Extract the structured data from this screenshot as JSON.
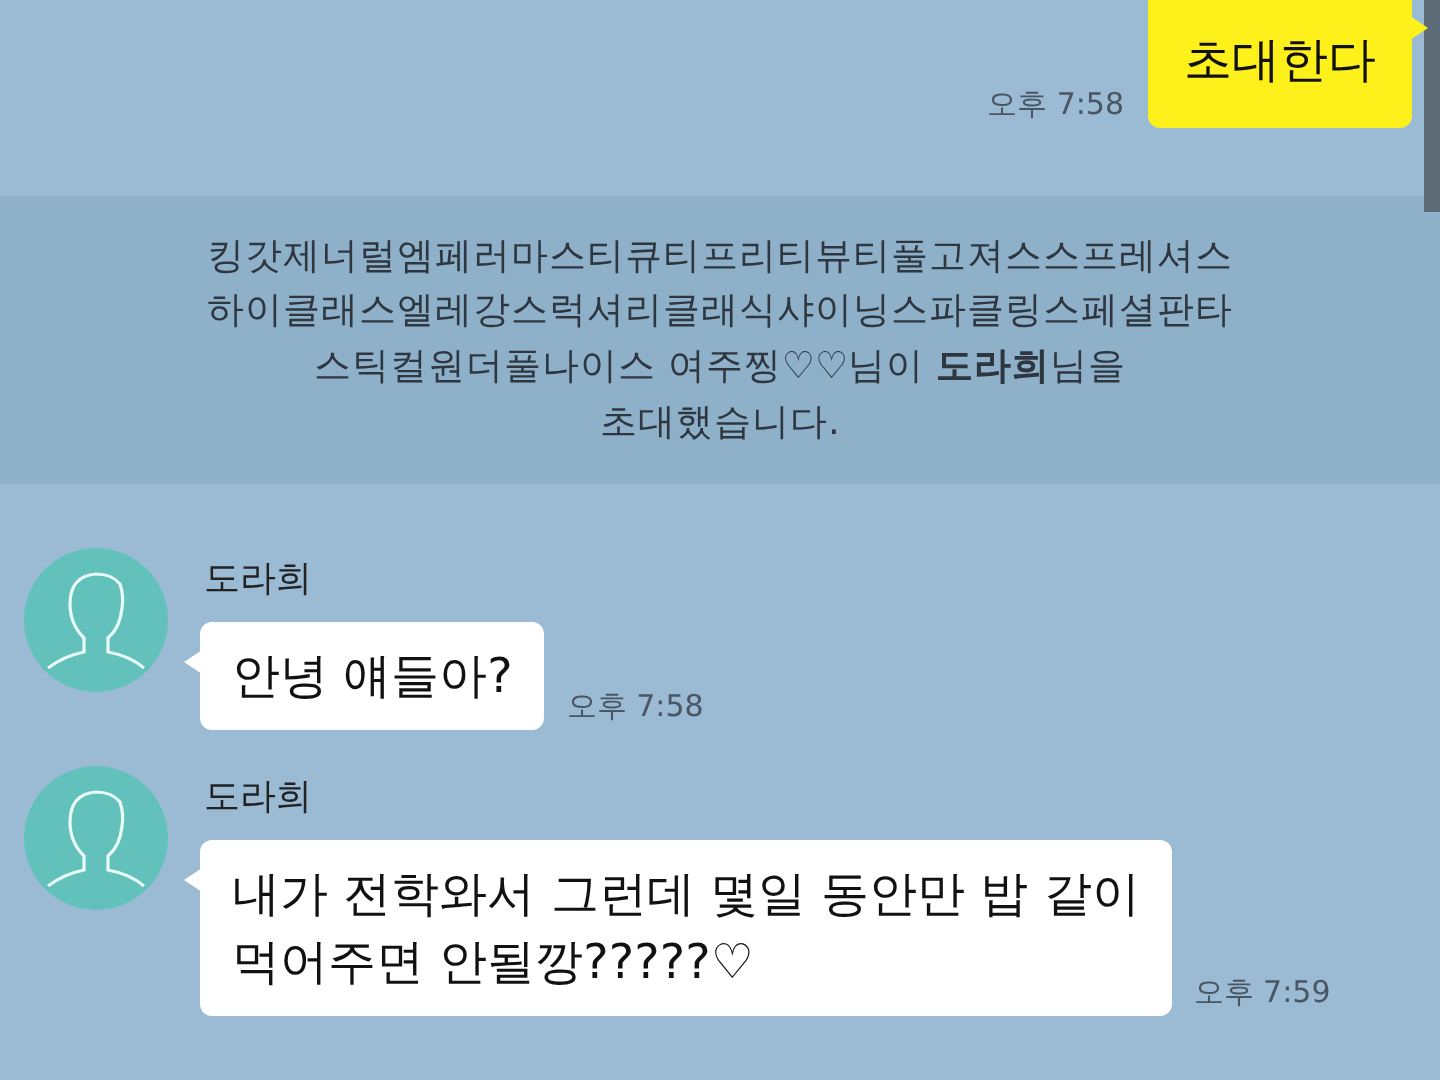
{
  "messages": [
    {
      "kind": "outgoing",
      "text": "초대한다",
      "time": "오후 7:58"
    },
    {
      "kind": "notice",
      "text": "킹갓제너럴엠페러마스티큐티프리티뷰티풀고져스스프레셔스\n하이클래스엘레강스럭셔리클래식샤이닝스파클링스페셜판타\n스틱컬원더풀나이스 여주찡♡♡님이 **도라희**님을\n초대했습니다."
    },
    {
      "kind": "incoming",
      "sender": "도라희",
      "text": "안녕 얘들아?",
      "time": "오후 7:58"
    },
    {
      "kind": "incoming",
      "sender": "도라희",
      "text": "내가 전학와서 그런데 몇일 동안만 밥 같이\n먹어주면 안될깡?????♡",
      "time": "오후 7:59"
    }
  ]
}
